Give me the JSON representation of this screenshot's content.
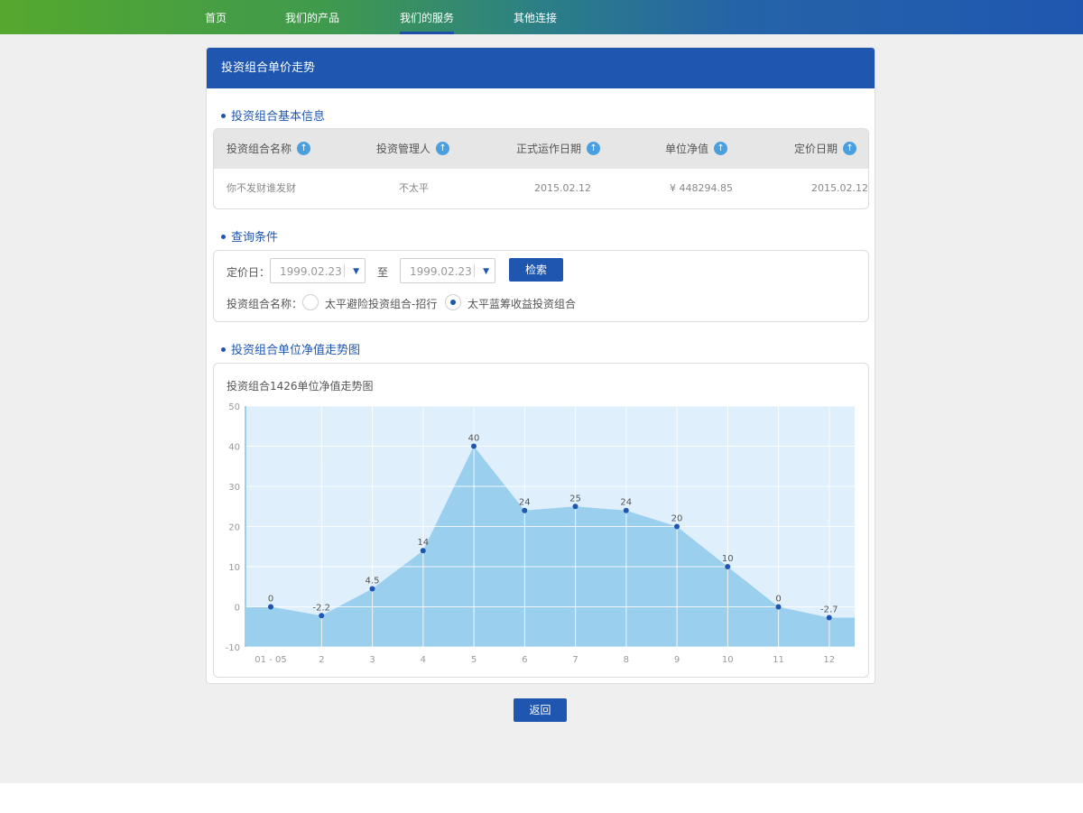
{
  "nav": {
    "items": [
      {
        "label": "首页",
        "active": false
      },
      {
        "label": "我们的产品",
        "active": false
      },
      {
        "label": "我们的服务",
        "active": true
      },
      {
        "label": "其他连接",
        "active": false
      }
    ]
  },
  "card": {
    "title": "投资组合单价走势"
  },
  "basic_info": {
    "section_title": "投资组合基本信息",
    "columns": [
      "投资组合名称",
      "投资管理人",
      "正式运作日期",
      "单位净值",
      "定价日期"
    ],
    "row": [
      "你不发财谁发财",
      "不太平",
      "2015.02.12",
      "¥ 448294.85",
      "2015.02.12"
    ],
    "sort_icon": "arrow-up-circle-icon"
  },
  "query": {
    "section_title": "查询条件",
    "date_label": "定价日：",
    "date_from": "1999.02.23",
    "to_label": "至",
    "date_to": "1999.02.23",
    "search_label": "检索",
    "name_label": "投资组合名称：",
    "options": [
      {
        "label": "太平避险投资组合-招行",
        "selected": false
      },
      {
        "label": "太平蓝筹收益投资组合",
        "selected": true
      }
    ]
  },
  "trend": {
    "section_title": "投资组合单位净值走势图",
    "chart_title": "投资组合1426单位净值走势图"
  },
  "chart_data": {
    "type": "area",
    "title": "投资组合1426单位净值走势图",
    "categories": [
      "01 - 05",
      "2",
      "3",
      "4",
      "5",
      "6",
      "7",
      "8",
      "9",
      "10",
      "11",
      "12"
    ],
    "values": [
      0,
      -2.2,
      4.5,
      14,
      40,
      24,
      25,
      24,
      20,
      10,
      0,
      -2.7
    ],
    "ylim": [
      -10,
      50
    ],
    "yticks": [
      -10,
      0,
      10,
      20,
      30,
      40,
      50
    ],
    "grid": true,
    "colors": {
      "fill": "#9bcfee",
      "plot_bg": "#dff0fc",
      "point": "#1f57b0",
      "grid": "#ffffff"
    }
  },
  "footer": {
    "back_label": "返回"
  },
  "colors": {
    "primary": "#1f57b0",
    "nav_gradient_start": "#55a82e",
    "nav_gradient_end": "#1f57b0"
  }
}
